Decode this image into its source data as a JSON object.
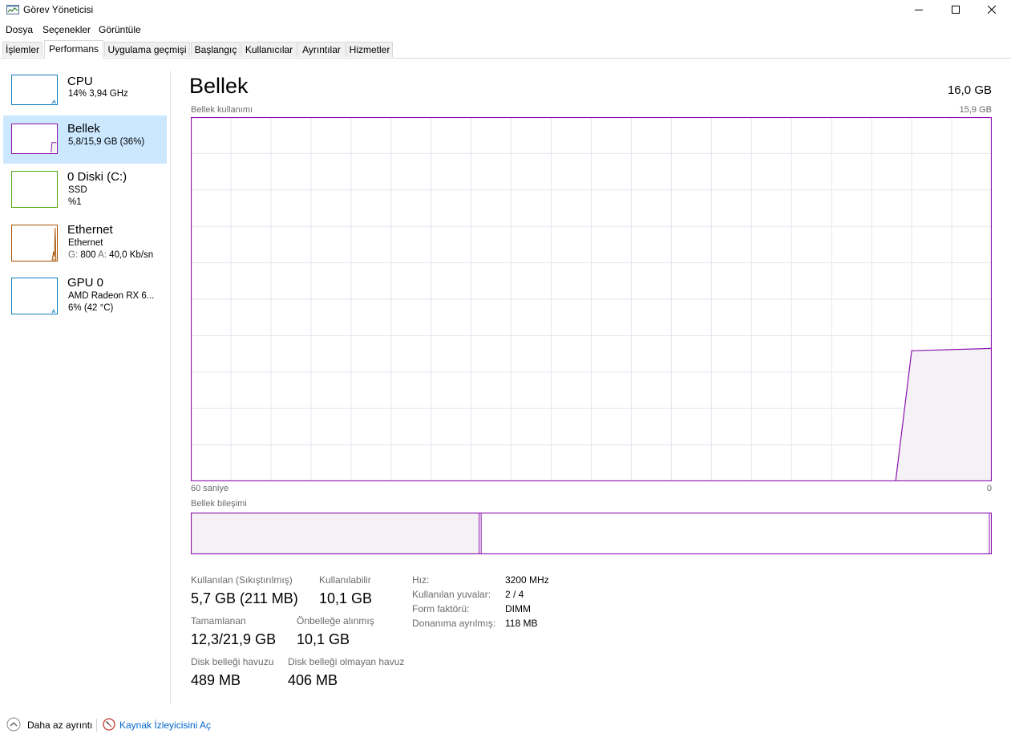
{
  "window": {
    "title": "Görev Yöneticisi"
  },
  "menu": [
    "Dosya",
    "Seçenekler",
    "Görüntüle"
  ],
  "tabs": [
    "İşlemler",
    "Performans",
    "Uygulama geçmişi",
    "Başlangıç",
    "Kullanıcılar",
    "Ayrıntılar",
    "Hizmetler"
  ],
  "active_tab": "Performans",
  "sidebar": {
    "items": [
      {
        "title": "CPU",
        "line1": "14%  3,94 GHz",
        "color": "#117dbb"
      },
      {
        "title": "Bellek",
        "line1": "5,8/15,9 GB (36%)",
        "color": "#8b12ae",
        "selected": true
      },
      {
        "title": "0 Diski (C:)",
        "line1": "SSD",
        "line2": "%1",
        "color": "#4da60c"
      },
      {
        "title": "Ethernet",
        "line1": "Ethernet",
        "line2_g_label": "G:",
        "line2_g_value": "800",
        "line2_a_label": "A:",
        "line2_a_value": "40,0 Kb/sn",
        "color": "#a74f01"
      },
      {
        "title": "GPU 0",
        "line1": "AMD Radeon RX 6...",
        "line2": "6%  (42 °C)",
        "color": "#117dbb"
      }
    ]
  },
  "main": {
    "title": "Bellek",
    "total": "16,0 GB",
    "usage_label": "Bellek kullanımı",
    "usage_max": "15,9 GB",
    "x_left": "60 saniye",
    "x_right": "0",
    "composition_label": "Bellek bileşimi",
    "accent": "#8b12ae",
    "fill": "#f4f2f4",
    "grid": "#e5e5ef"
  },
  "chart_data": {
    "type": "area",
    "title": "Bellek kullanımı",
    "xlabel": "",
    "ylabel": "",
    "xlim": [
      60,
      0
    ],
    "ylim": [
      0,
      15.9
    ],
    "x": [
      60,
      7.2,
      6.0,
      0
    ],
    "series": [
      {
        "values": [
          0,
          0,
          5.7,
          5.8
        ]
      }
    ],
    "grid": true
  },
  "composition": {
    "in_use_fraction": 0.36,
    "standby_end_fraction": 0.997
  },
  "stats": {
    "in_use_label": "Kullanılan (Sıkıştırılmış)",
    "in_use_value": "5,7 GB (211 MB)",
    "available_label": "Kullanılabilir",
    "available_value": "10,1 GB",
    "committed_label": "Tamamlanan",
    "committed_value": "12,3/21,9 GB",
    "cached_label": "Önbelleğe alınmış",
    "cached_value": "10,1 GB",
    "paged_label": "Disk belleği havuzu",
    "paged_value": "489 MB",
    "nonpaged_label": "Disk belleği olmayan havuz",
    "nonpaged_value": "406 MB"
  },
  "details": [
    {
      "label": "Hız:",
      "value": "3200 MHz"
    },
    {
      "label": "Kullanılan yuvalar:",
      "value": "2 / 4"
    },
    {
      "label": "Form faktörü:",
      "value": "DIMM"
    },
    {
      "label": "Donanıma ayrılmış:",
      "value": "118 MB"
    }
  ],
  "footer": {
    "less_details": "Daha az ayrıntı",
    "resource_monitor": "Kaynak İzleyicisini Aç",
    "link_color": "#0066cc"
  }
}
